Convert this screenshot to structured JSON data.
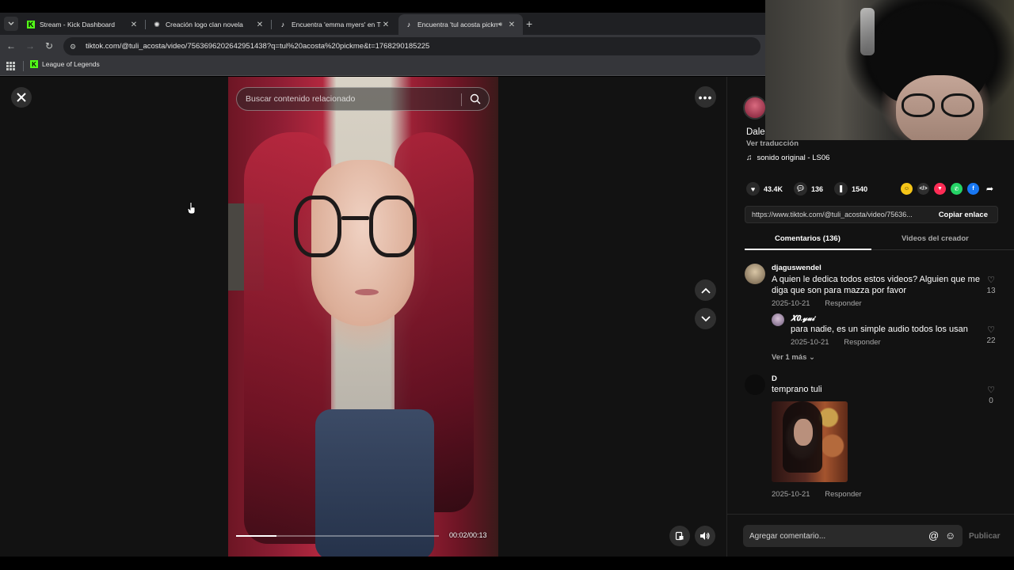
{
  "browser": {
    "tabs": [
      {
        "title": "Stream - Kick Dashboard",
        "favicon": "kick-logo-icon",
        "active": false
      },
      {
        "title": "Creación logo clan novela",
        "favicon": "chatgpt-logo-icon",
        "active": false
      },
      {
        "title": "Encuentra 'emma myers' en Tik",
        "favicon": "tiktok-logo-icon",
        "active": false
      },
      {
        "title": "Encuentra 'tul acosta pickm",
        "favicon": "tiktok-logo-icon",
        "active": true
      }
    ],
    "url": "tiktok.com/@tuli_acosta/video/7563696202642951438?q=tul%20acosta%20pickme&t=1768290185225",
    "bookmark": "League of Legends"
  },
  "video": {
    "search_placeholder": "Buscar contenido relacionado",
    "time": "00:02/00:13",
    "progress": 0.2
  },
  "panel": {
    "description": "Dale",
    "translate": "Ver traducción",
    "sound": "sonido original - LS06",
    "likes": "43.4K",
    "comments_count": "136",
    "saves": "1540",
    "share_link": "https://www.tiktok.com/@tuli_acosta/video/75636...",
    "copy_label": "Copiar enlace",
    "tab_comments": "Comentarios (136)",
    "tab_creator": "Videos del creador"
  },
  "comments": [
    {
      "user": "djaguswendel",
      "text": "A quien le dedica todos estos videos? Alguien que me diga que son para mazza por favor",
      "date": "2025-10-21",
      "reply": "Responder",
      "likes": "13"
    },
    {
      "user": "𝑿𝟎.𝔂𝓾𝓲",
      "text": "para nadie, es un simple audio todos los usan",
      "date": "2025-10-21",
      "reply": "Responder",
      "likes": "22"
    },
    {
      "user": "D",
      "text": "temprano tuli",
      "date": "2025-10-21",
      "reply": "Responder",
      "likes": "0"
    }
  ],
  "more_replies": "Ver 1 más",
  "compose": {
    "placeholder": "Agregar comentario...",
    "post": "Publicar"
  }
}
